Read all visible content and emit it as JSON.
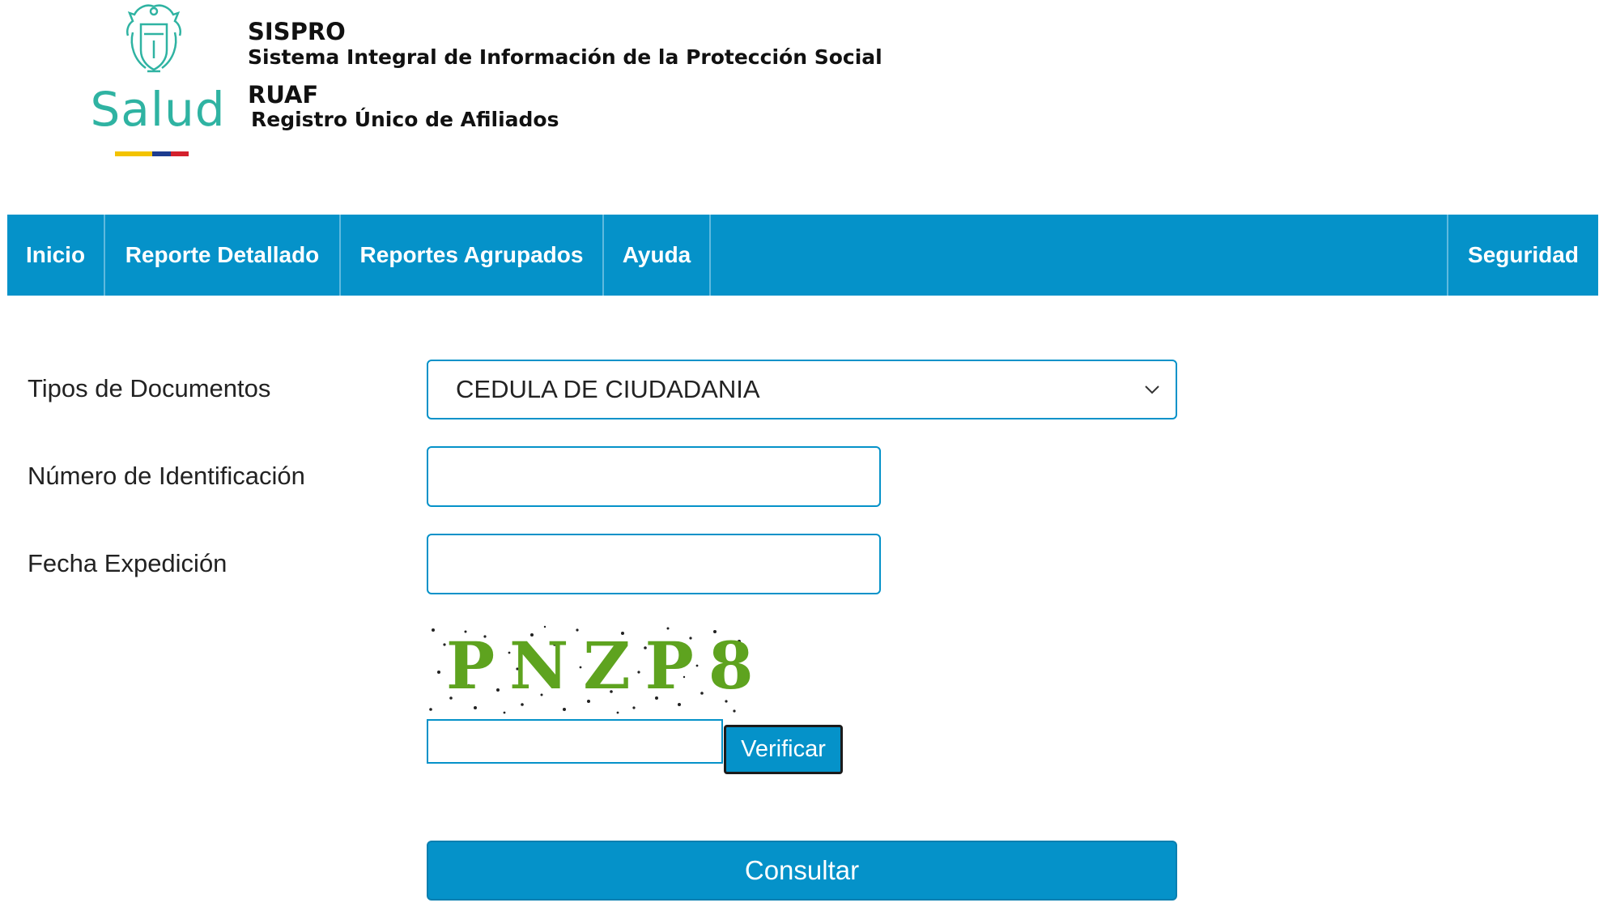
{
  "header": {
    "logo_text": "Salud",
    "system_name": "SISPRO",
    "system_full": "Sistema Integral de Información de la Protección Social",
    "module_name": "RUAF",
    "module_full": "Registro Único de Afiliados",
    "flag_colors": [
      "#f3c300",
      "#1d3c8f",
      "#d3212d"
    ]
  },
  "nav": {
    "items": [
      {
        "label": "Inicio"
      },
      {
        "label": "Reporte Detallado"
      },
      {
        "label": "Reportes Agrupados"
      },
      {
        "label": "Ayuda"
      }
    ],
    "right_item": {
      "label": "Seguridad"
    }
  },
  "form": {
    "doc_type_label": "Tipos de Documentos",
    "doc_type_selected": "CEDULA DE CIUDADANIA",
    "id_label": "Número de Identificación",
    "id_value": "",
    "date_label": "Fecha Expedición",
    "date_value": "",
    "captcha_text": "PNZP8",
    "captcha_value": "",
    "verify_label": "Verificar",
    "submit_label": "Consultar"
  },
  "colors": {
    "accent": "#0592c9",
    "logo_teal": "#2fb3a2",
    "captcha_green": "#5ea31f"
  }
}
